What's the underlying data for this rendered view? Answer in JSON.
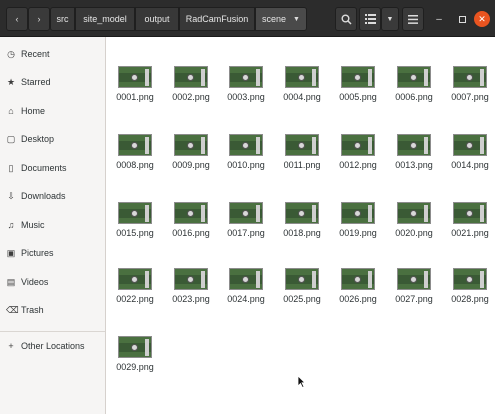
{
  "headerbar": {
    "breadcrumbs": [
      "src",
      "site_model",
      "output",
      "RadCamFusion",
      "scene"
    ]
  },
  "sidebar": {
    "items": [
      {
        "label": "Recent",
        "icon": "clock-icon"
      },
      {
        "label": "Starred",
        "icon": "star-icon"
      },
      {
        "label": "Home",
        "icon": "home-icon"
      },
      {
        "label": "Desktop",
        "icon": "desktop-icon"
      },
      {
        "label": "Documents",
        "icon": "document-icon"
      },
      {
        "label": "Downloads",
        "icon": "download-icon"
      },
      {
        "label": "Music",
        "icon": "music-icon"
      },
      {
        "label": "Pictures",
        "icon": "pictures-icon"
      },
      {
        "label": "Videos",
        "icon": "video-icon"
      },
      {
        "label": "Trash",
        "icon": "trash-icon"
      },
      {
        "label": "Other Locations",
        "icon": "plus-icon"
      }
    ]
  },
  "files": [
    "0001.png",
    "0002.png",
    "0003.png",
    "0004.png",
    "0005.png",
    "0006.png",
    "0007.png",
    "0008.png",
    "0009.png",
    "0010.png",
    "0011.png",
    "0012.png",
    "0013.png",
    "0014.png",
    "0015.png",
    "0016.png",
    "0017.png",
    "0018.png",
    "0019.png",
    "0020.png",
    "0021.png",
    "0022.png",
    "0023.png",
    "0024.png",
    "0025.png",
    "0026.png",
    "0027.png",
    "0028.png",
    "0029.png"
  ]
}
